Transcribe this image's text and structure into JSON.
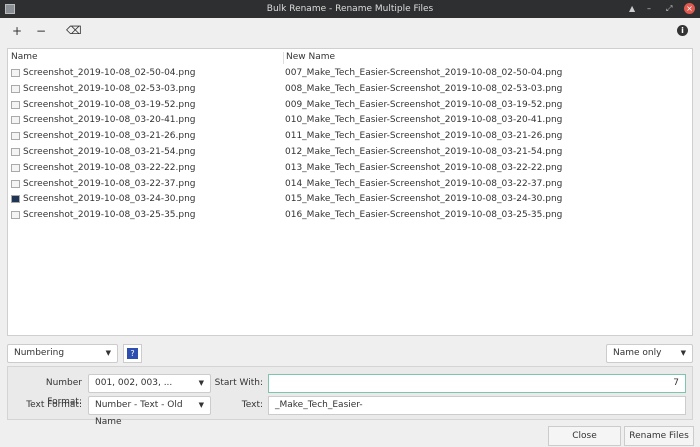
{
  "window": {
    "title": "Bulk Rename - Rename Multiple Files"
  },
  "toolbar": {
    "add": "+",
    "remove": "−",
    "clear": "⌫",
    "info": "i"
  },
  "list": {
    "columns": [
      "Name",
      "New Name"
    ],
    "rows": [
      {
        "old": "Screenshot_2019-10-08_02-50-04.png",
        "new": "007_Make_Tech_Easier-Screenshot_2019-10-08_02-50-04.png"
      },
      {
        "old": "Screenshot_2019-10-08_02-53-03.png",
        "new": "008_Make_Tech_Easier-Screenshot_2019-10-08_02-53-03.png"
      },
      {
        "old": "Screenshot_2019-10-08_03-19-52.png",
        "new": "009_Make_Tech_Easier-Screenshot_2019-10-08_03-19-52.png"
      },
      {
        "old": "Screenshot_2019-10-08_03-20-41.png",
        "new": "010_Make_Tech_Easier-Screenshot_2019-10-08_03-20-41.png"
      },
      {
        "old": "Screenshot_2019-10-08_03-21-26.png",
        "new": "011_Make_Tech_Easier-Screenshot_2019-10-08_03-21-26.png"
      },
      {
        "old": "Screenshot_2019-10-08_03-21-54.png",
        "new": "012_Make_Tech_Easier-Screenshot_2019-10-08_03-21-54.png"
      },
      {
        "old": "Screenshot_2019-10-08_03-22-22.png",
        "new": "013_Make_Tech_Easier-Screenshot_2019-10-08_03-22-22.png"
      },
      {
        "old": "Screenshot_2019-10-08_03-22-37.png",
        "new": "014_Make_Tech_Easier-Screenshot_2019-10-08_03-22-37.png"
      },
      {
        "old": "Screenshot_2019-10-08_03-24-30.png",
        "new": "015_Make_Tech_Easier-Screenshot_2019-10-08_03-24-30.png"
      },
      {
        "old": "Screenshot_2019-10-08_03-25-35.png",
        "new": "016_Make_Tech_Easier-Screenshot_2019-10-08_03-25-35.png"
      }
    ]
  },
  "controls": {
    "mode": "Numbering",
    "help": "?",
    "scope": "Name only"
  },
  "options": {
    "number_format_label": "Number Format:",
    "number_format": "001, 002, 003, ...",
    "start_with_label": "Start With:",
    "start_with": "7",
    "text_format_label": "Text Format:",
    "text_format": "Number - Text - Old Name",
    "text_label": "Text:",
    "text": "_Make_Tech_Easier-"
  },
  "buttons": {
    "close": "Close",
    "rename": "Rename Files"
  }
}
